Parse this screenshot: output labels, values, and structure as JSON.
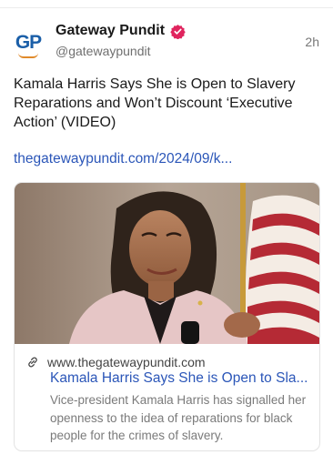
{
  "post": {
    "author_name": "Gateway Pundit",
    "author_handle": "@gatewaypundit",
    "avatar_text": "GP",
    "time": "2h",
    "text": "Kamala Harris Says She is Open to Slavery Reparations and Won’t Discount ‘Executive Action’ (VIDEO)",
    "link_text": "thegatewaypundit.com/2024/09/k..."
  },
  "link_card": {
    "domain": "www.thegatewaypundit.com",
    "title": "Kamala Harris Says She is Open to Sla...",
    "description": "Vice-president Kamala Harris has signalled her openness to the idea of reparations for black people for the crimes of slavery."
  },
  "icons": {
    "verified": "verified-badge-icon",
    "link": "link-icon"
  },
  "colors": {
    "link_blue": "#2b56b8",
    "verified_red": "#e0245e",
    "logo_blue": "#1b5fa8"
  }
}
